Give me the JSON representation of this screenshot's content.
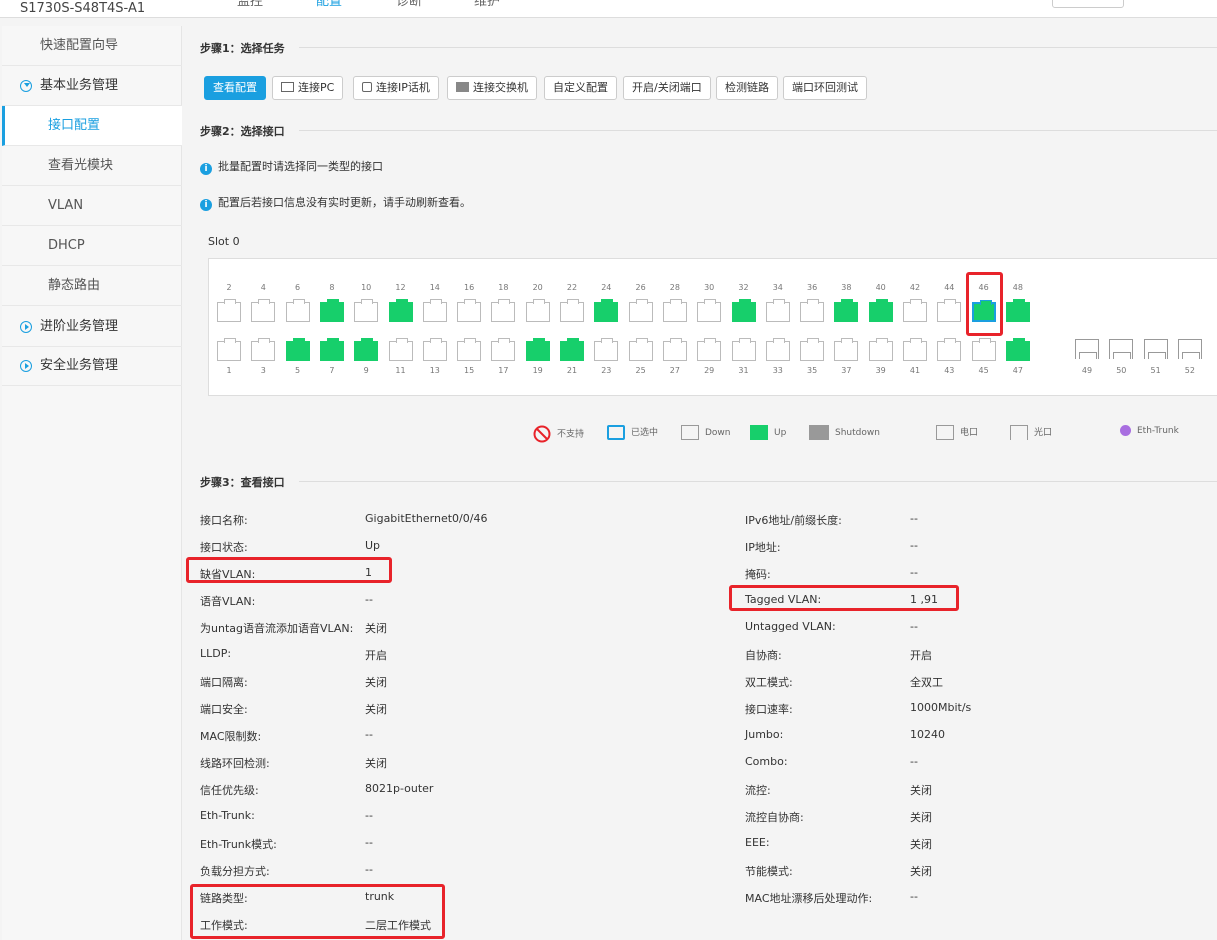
{
  "header": {
    "device_name": "S1730S-S48T4S-A1",
    "tabs": [
      "监控",
      "配置",
      "诊断",
      "维护"
    ],
    "active_tab": "配置"
  },
  "sidebar": {
    "items": [
      {
        "label": "快速配置向导"
      },
      {
        "label": "基本业务管理"
      },
      {
        "label": "接口配置"
      },
      {
        "label": "查看光模块"
      },
      {
        "label": "VLAN"
      },
      {
        "label": "DHCP"
      },
      {
        "label": "静态路由"
      },
      {
        "label": "进阶业务管理"
      },
      {
        "label": "安全业务管理"
      }
    ]
  },
  "steps": {
    "step1": "步骤1：选择任务",
    "step2": "步骤2：选择接口",
    "step3": "步骤3：查看接口"
  },
  "tasks": [
    "查看配置",
    "连接PC",
    "连接IP话机",
    "连接交换机",
    "自定义配置",
    "开启/关闭端口",
    "检测链路",
    "端口环回测试"
  ],
  "tips": {
    "tip1": "批量配置时请选择同一类型的接口",
    "tip2": "配置后若接口信息没有实时更新，请手动刷新查看。"
  },
  "slot": {
    "label": "Slot 0",
    "top_numbers": [
      "2",
      "4",
      "6",
      "8",
      "10",
      "12",
      "14",
      "16",
      "18",
      "20",
      "22",
      "24",
      "26",
      "28",
      "30",
      "32",
      "34",
      "36",
      "38",
      "40",
      "42",
      "44",
      "46",
      "48"
    ],
    "bottom_numbers": [
      "1",
      "3",
      "5",
      "7",
      "9",
      "11",
      "13",
      "15",
      "17",
      "19",
      "21",
      "23",
      "25",
      "27",
      "29",
      "31",
      "33",
      "35",
      "37",
      "39",
      "41",
      "43",
      "45",
      "47"
    ],
    "sfp_numbers": [
      "49",
      "50",
      "51",
      "52"
    ],
    "up_ports": [
      8,
      12,
      24,
      32,
      38,
      40,
      46,
      48,
      5,
      7,
      9,
      19,
      21,
      47
    ],
    "selected_port": 46
  },
  "legend": {
    "unsupported": "不支持",
    "selected": "已选中",
    "down": "Down",
    "up": "Up",
    "shutdown": "Shutdown",
    "electric": "电口",
    "optical": "光口",
    "eth_trunk": "Eth-Trunk",
    "colors": {
      "up": "#17cf6b",
      "selected": "#1a9fe0",
      "shutdown": "#999999",
      "unsupported": "#e8232a",
      "eth_trunk": "#a86ee0"
    }
  },
  "details": {
    "left": [
      {
        "label": "接口名称:",
        "value": "GigabitEthernet0/0/46"
      },
      {
        "label": "接口状态:",
        "value": "Up"
      },
      {
        "label": "缺省VLAN:",
        "value": "1"
      },
      {
        "label": "语音VLAN:",
        "value": "--"
      },
      {
        "label": "为untag语音流添加语音VLAN:",
        "value": "关闭"
      },
      {
        "label": "LLDP:",
        "value": "开启"
      },
      {
        "label": "端口隔离:",
        "value": "关闭"
      },
      {
        "label": "端口安全:",
        "value": "关闭"
      },
      {
        "label": "MAC限制数:",
        "value": "--"
      },
      {
        "label": "线路环回检测:",
        "value": "关闭"
      },
      {
        "label": "信任优先级:",
        "value": "8021p-outer"
      },
      {
        "label": "Eth-Trunk:",
        "value": "--"
      },
      {
        "label": "Eth-Trunk模式:",
        "value": "--"
      },
      {
        "label": "负载分担方式:",
        "value": "--"
      },
      {
        "label": "链路类型:",
        "value": "trunk"
      },
      {
        "label": "工作模式:",
        "value": "二层工作模式"
      }
    ],
    "right": [
      {
        "label": "IPv6地址/前缀长度:",
        "value": "--"
      },
      {
        "label": "IP地址:",
        "value": "--"
      },
      {
        "label": "掩码:",
        "value": "--"
      },
      {
        "label": "Tagged VLAN:",
        "value": "1 ,91"
      },
      {
        "label": "Untagged VLAN:",
        "value": "--"
      },
      {
        "label": "自协商:",
        "value": "开启"
      },
      {
        "label": "双工模式:",
        "value": "全双工"
      },
      {
        "label": "接口速率:",
        "value": "1000Mbit/s"
      },
      {
        "label": "Jumbo:",
        "value": "10240"
      },
      {
        "label": "Combo:",
        "value": "--"
      },
      {
        "label": "流控:",
        "value": "关闭"
      },
      {
        "label": "流控自协商:",
        "value": "关闭"
      },
      {
        "label": "EEE:",
        "value": "关闭"
      },
      {
        "label": "节能模式:",
        "value": "关闭"
      },
      {
        "label": "MAC地址漂移后处理动作:",
        "value": "--"
      }
    ]
  }
}
